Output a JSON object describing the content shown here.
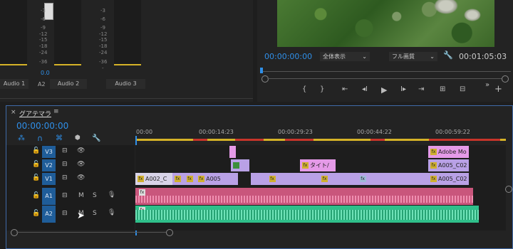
{
  "mixer": {
    "db_scale": [
      "-3",
      "-6",
      "-9",
      "-12",
      "-15",
      "-18",
      "-24",
      "-36"
    ],
    "db_scale_ch3": [
      "-3",
      "-6",
      "-9",
      "-12",
      "-15",
      "-18",
      "-24",
      "-36",
      "-"
    ],
    "level": "0.0",
    "channel_a2": "A2",
    "channels": [
      "Audio 1",
      "Audio 2",
      "Audio 3"
    ]
  },
  "monitor": {
    "timecode_current": "00:00:00:00",
    "zoom": "全体表示",
    "quality": "フル画質",
    "timecode_duration": "00:01:05:03",
    "controls": [
      "{",
      "}",
      "⇤",
      "◂I",
      "▶",
      "I▸",
      "⇥",
      "⊞",
      "⊟",
      "»",
      "+"
    ]
  },
  "timeline": {
    "close": "×",
    "sequence_name": "グアテマラ",
    "menu": "≡",
    "playhead": "00:00:00:00",
    "ruler": [
      "00:00",
      "00:00:14:23",
      "00:00:29:23",
      "00:00:44:22",
      "00:00:59:22"
    ],
    "tracks": [
      {
        "id": "V3",
        "toggle": "👁"
      },
      {
        "id": "V2",
        "toggle": "👁"
      },
      {
        "id": "V1",
        "toggle": "👁"
      },
      {
        "id": "A1",
        "mute": "M",
        "solo": "S"
      },
      {
        "id": "A2",
        "mute": "M",
        "solo": "S"
      }
    ],
    "clips": {
      "v3_adobe": "Adobe Mo",
      "v2_title": "タイト/",
      "v2_a005": "A005_C02",
      "v1_a002": "A002_C",
      "v1_a005": "A005",
      "v1_a005_end": "A005_C02"
    },
    "fx": "fx",
    "colors": {
      "video": "#b9a1e6",
      "audio1": "#c9567c",
      "audio2": "#2fbf8a",
      "title": "#e59ae8",
      "track_selected": "#1f5d99",
      "accent": "#2f8fe8"
    }
  }
}
